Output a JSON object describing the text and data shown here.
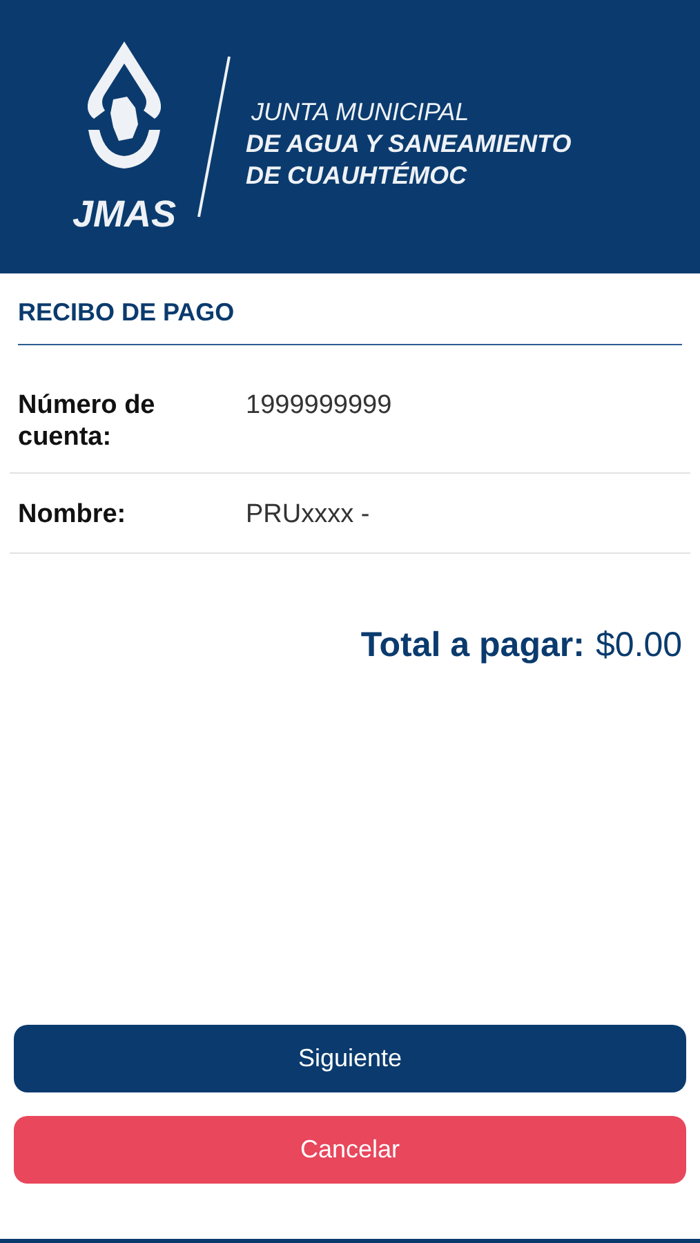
{
  "header": {
    "logo_text": "JMAS",
    "org_lines": [
      "JUNTA MUNICIPAL",
      "DE AGUA Y SANEAMIENTO",
      "DE CUAUHTÉMOC"
    ]
  },
  "section_title": "RECIBO DE PAGO",
  "details": [
    {
      "label": "Número de cuenta:",
      "value": "1999999999"
    },
    {
      "label": "Nombre:",
      "value": "PRUxxxx -"
    }
  ],
  "total": {
    "label": "Total a pagar:",
    "value": "$0.00"
  },
  "buttons": [
    {
      "label": "Siguiente",
      "kind": "primary"
    },
    {
      "label": "Cancelar",
      "kind": "danger"
    }
  ]
}
